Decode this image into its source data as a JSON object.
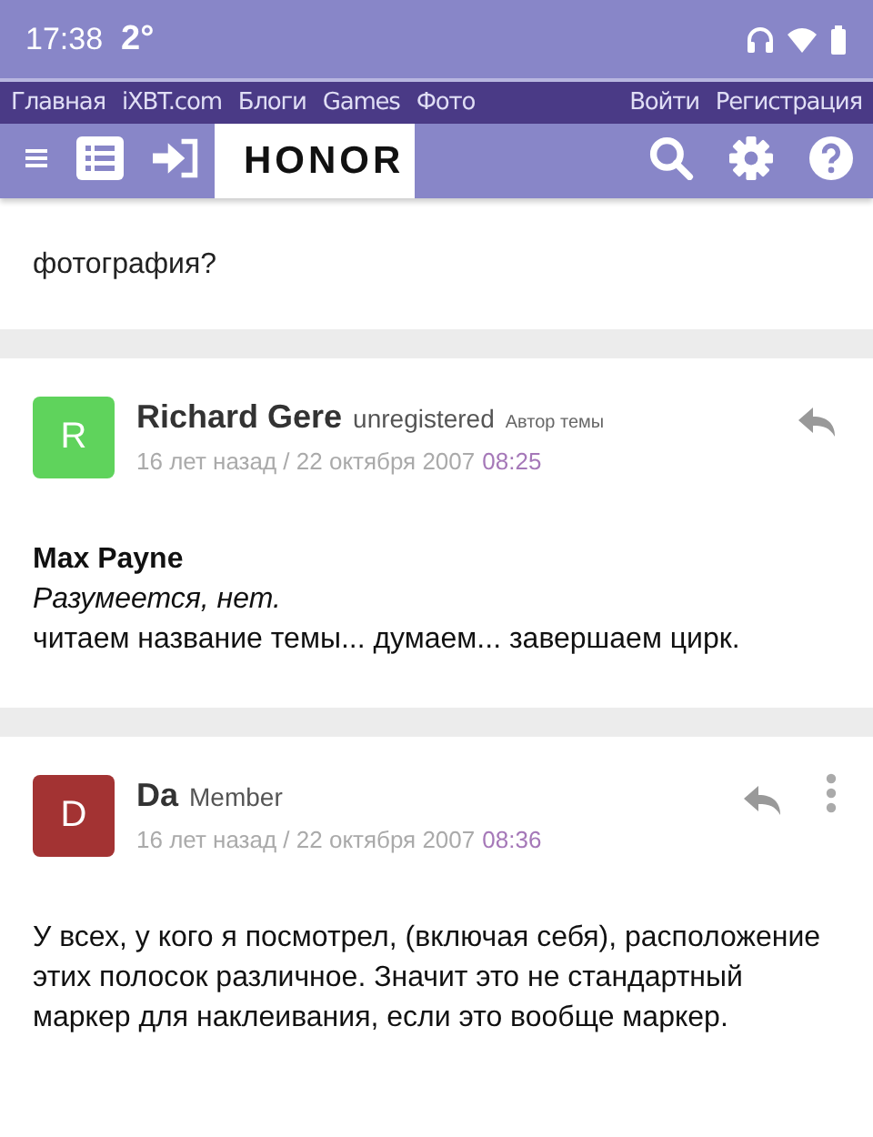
{
  "status_bar": {
    "time": "17:38",
    "temperature": "2°"
  },
  "nav": {
    "links": [
      "Главная",
      "iXBT.com",
      "Блоги",
      "Games",
      "Фото"
    ],
    "auth": [
      "Войти",
      "Регистрация"
    ]
  },
  "toolbar": {
    "logo": "HONOR"
  },
  "fragment": "фотография?",
  "posts": [
    {
      "avatar": "R",
      "color": "#5fd35c",
      "author": "Richard Gere",
      "role": "unregistered",
      "badge": "Автор темы",
      "ago": "16 лет назад / 22 октября 2007",
      "time": "08:25",
      "more": false,
      "quote_author": "Max Payne",
      "quote": "Разумеется, нет.",
      "text": "читаем название темы... думаем... завершаем цирк."
    },
    {
      "avatar": "D",
      "color": "#a33333",
      "author": "Da",
      "role": "Member",
      "ago": "16 лет назад / 22 октября 2007",
      "time": "08:36",
      "more": true,
      "text": "У всех, у кого я посмотрел, (включая себя), расположение этих полосок различное. Значит это не стандартный маркер для наклеивания, если это вообще маркер."
    }
  ]
}
